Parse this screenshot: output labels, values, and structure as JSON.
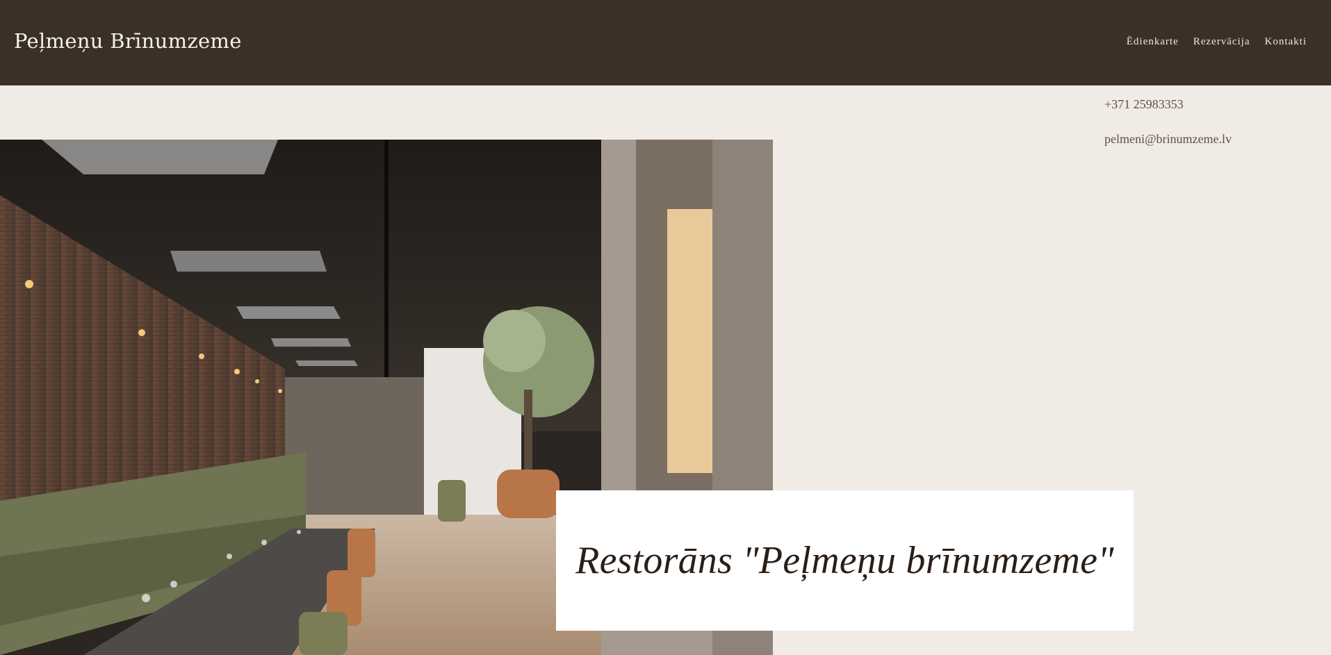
{
  "header": {
    "brand": "Peļmeņu Brīnumzeme",
    "nav": [
      {
        "label": "Ēdienkarte"
      },
      {
        "label": "Rezervācija"
      },
      {
        "label": "Kontakti"
      }
    ]
  },
  "contact": {
    "phone": "+371 25983353",
    "email": "pelmeni@brinumzeme.lv"
  },
  "hero": {
    "title": "Restorāns \"Peļmeņu brīnumzeme\"",
    "image_alt": "restaurant-interior-photo"
  },
  "colors": {
    "header_bg": "#3b3026",
    "page_bg": "#f0ebe5",
    "title_text": "#2a1e17"
  }
}
